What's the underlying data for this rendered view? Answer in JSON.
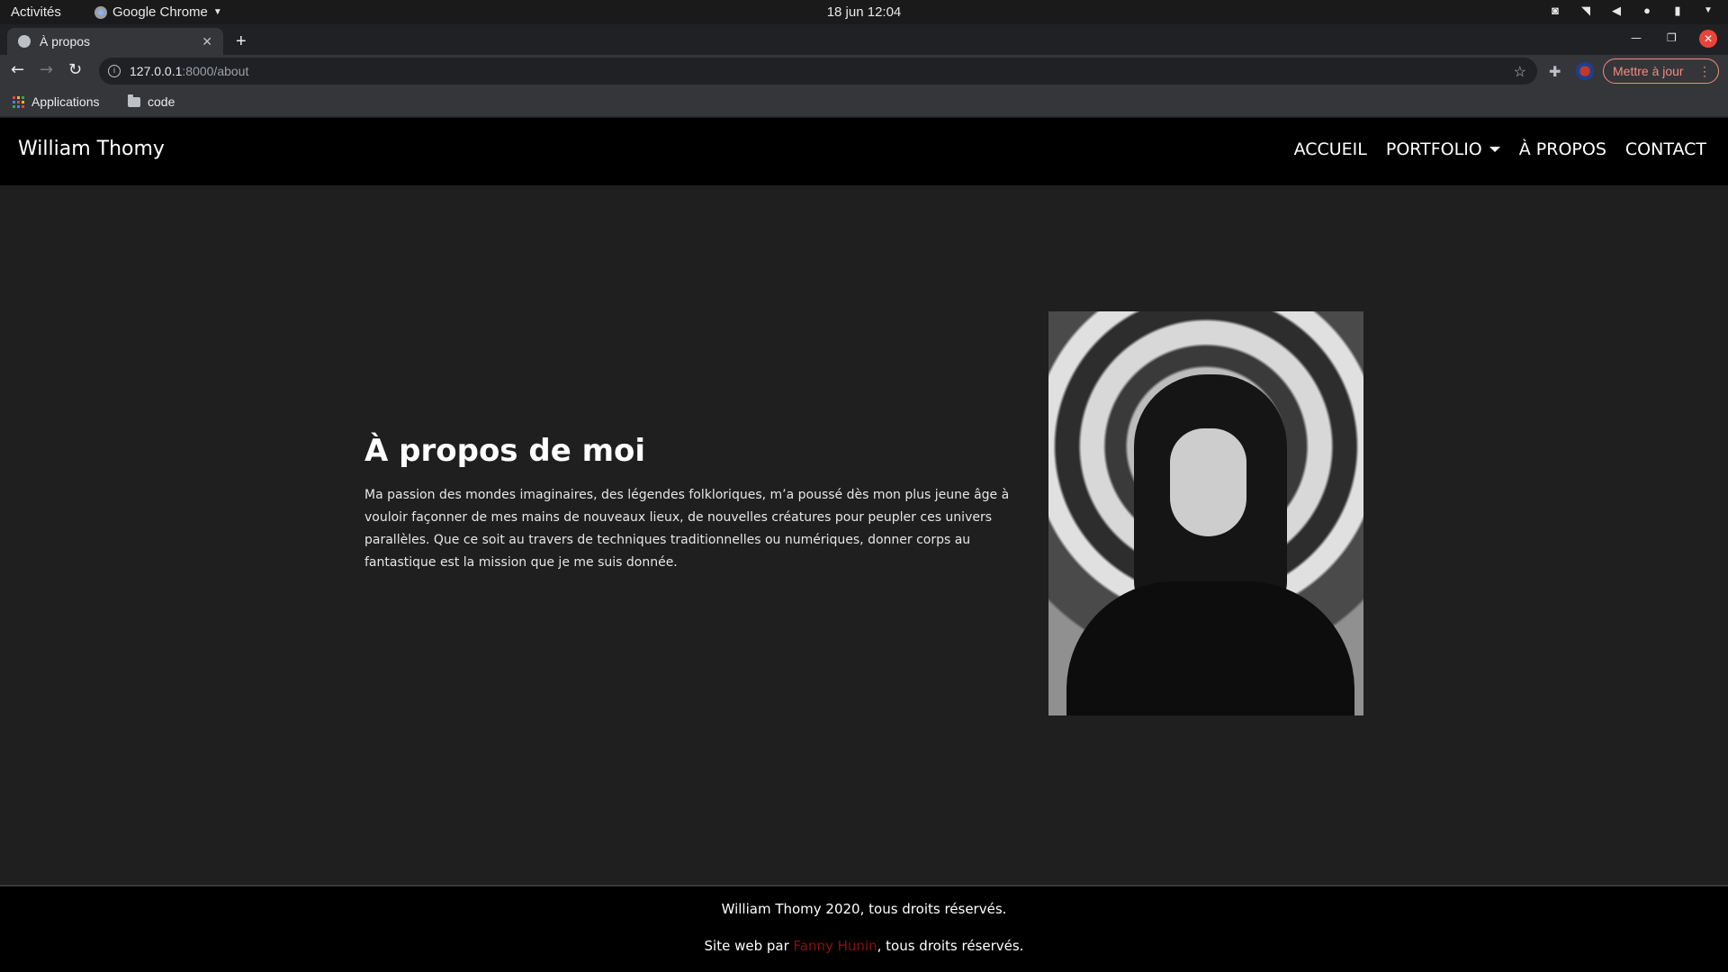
{
  "system_bar": {
    "activities": "Activités",
    "app_name": "Google Chrome",
    "clock": "18 jun  12:04"
  },
  "browser": {
    "tab_title": "À propos",
    "url_host": "127.0.0.1",
    "url_path": ":8000/about",
    "update_button": "Mettre à jour",
    "bookmarks": [
      {
        "label": "Applications",
        "icon": "apps-grid-icon"
      },
      {
        "label": "code",
        "icon": "folder-icon"
      }
    ]
  },
  "site": {
    "brand": "William Thomy",
    "nav": {
      "home": "ACCUEIL",
      "portfolio": "PORTFOLIO",
      "about": "À PROPOS",
      "contact": "CONTACT"
    },
    "about": {
      "title": "À propos de moi",
      "text": "Ma passion des mondes imaginaires, des légendes folkloriques, m’a poussé dès mon plus jeune âge à vouloir façonner de mes mains de nouveaux lieux, de nouvelles créatures pour peupler ces univers parallèles. Que ce soit au travers de techniques traditionnelles ou numériques, donner corps au fantastique est la mission que je me suis donnée."
    },
    "footer": {
      "copyright": "William Thomy 2020, tous droits réservés.",
      "credit_prefix": "Site web par ",
      "credit_name": "Fanny Hunin",
      "credit_suffix": ", tous droits réservés."
    }
  },
  "colors": {
    "page_bg": "#1f1f1f",
    "nav_bg": "#000000",
    "update_accent": "#f28b82",
    "credit_link": "#8a1010"
  }
}
